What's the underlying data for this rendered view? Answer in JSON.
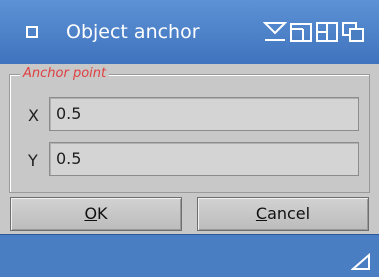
{
  "window": {
    "title": "Object anchor",
    "titlebar_icons": [
      "close-box-icon",
      "depth-icon",
      "zoom-icon",
      "iconify-icon",
      "snapshot-icon"
    ],
    "colors": {
      "titlebar": "#4a7ec2",
      "body": "#c8c8c8",
      "group_title": "#e04040"
    }
  },
  "anchor_group": {
    "title": "Anchor point",
    "x": {
      "label": "X",
      "value": "0.5"
    },
    "y": {
      "label": "Y",
      "value": "0.5"
    }
  },
  "buttons": {
    "ok": {
      "mnemonic": "O",
      "rest": "K"
    },
    "cancel": {
      "mnemonic": "C",
      "rest": "ancel"
    }
  }
}
